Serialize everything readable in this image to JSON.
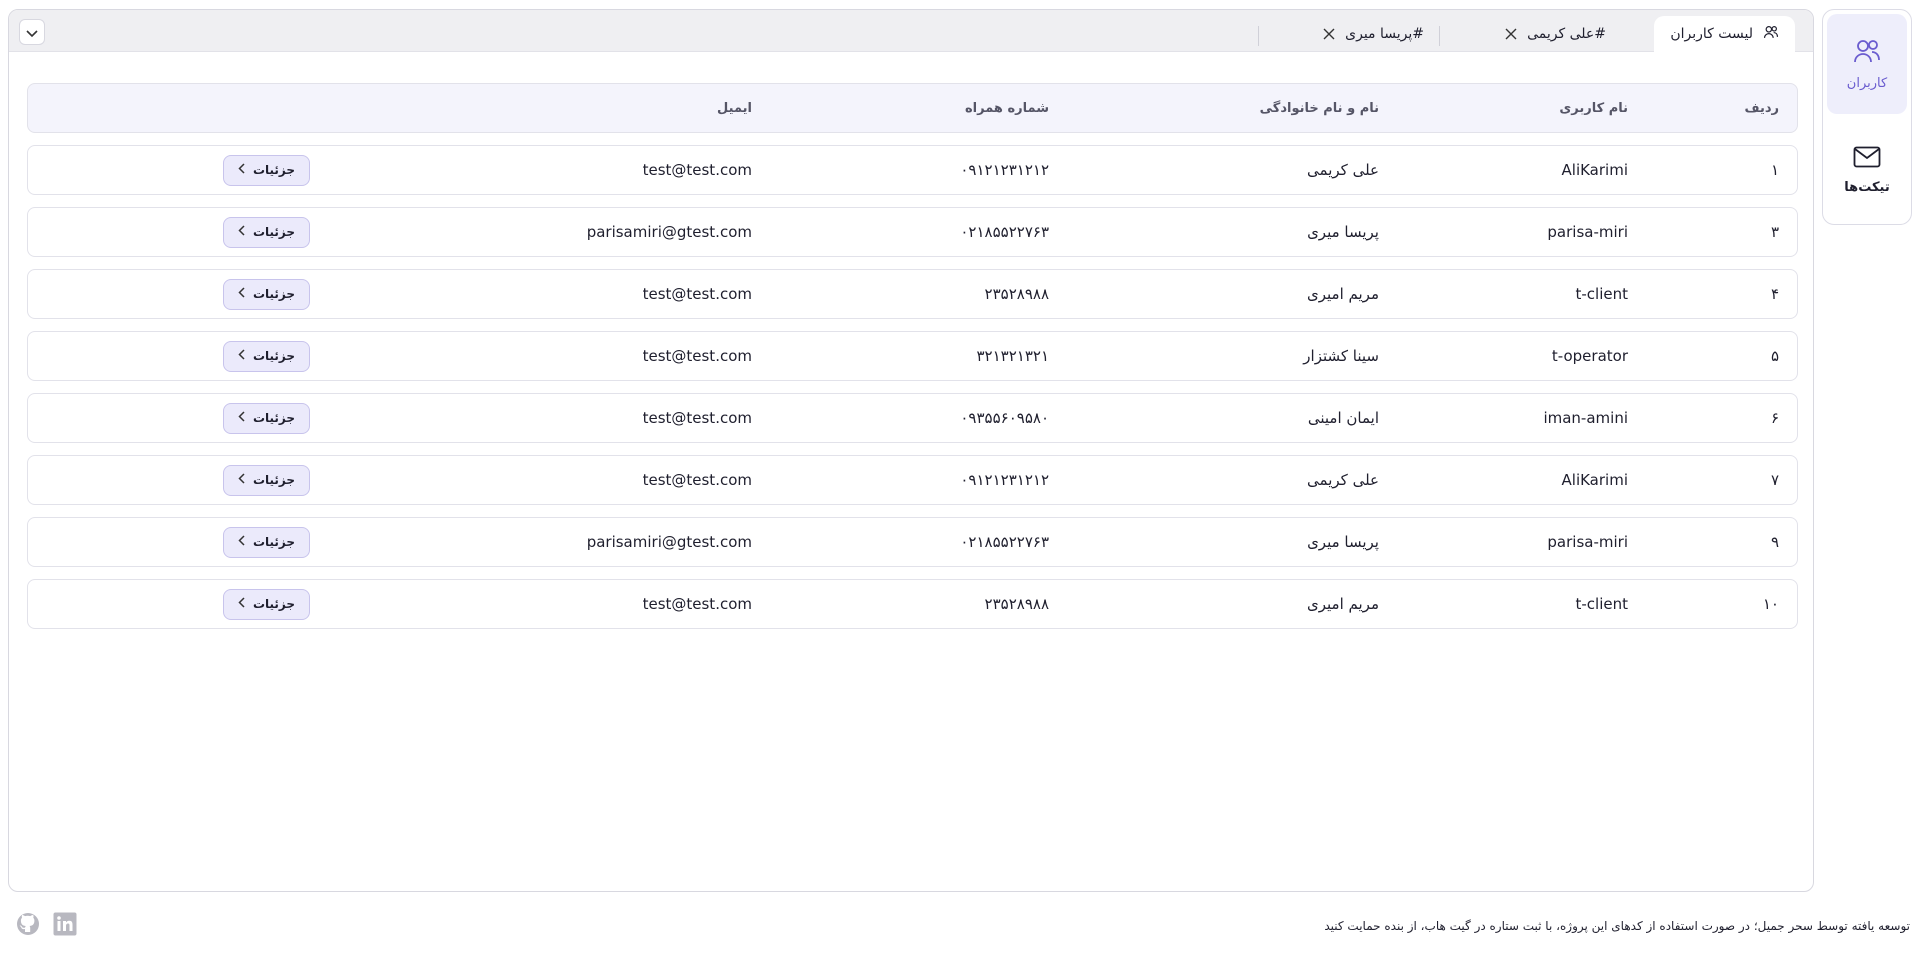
{
  "sidebar": {
    "items": [
      {
        "label": "کاربران",
        "icon": "users-icon",
        "active": true
      },
      {
        "label": "تیکت‌ها",
        "icon": "mail-icon",
        "active": false
      }
    ]
  },
  "tabs": [
    {
      "label": "لیست کاربران",
      "icon": "users-icon",
      "active": true
    },
    {
      "label": "#علی کریمی",
      "closable": true
    },
    {
      "label": "#پریسا میری",
      "closable": true
    }
  ],
  "table": {
    "headers": {
      "index": "ردیف",
      "username": "نام کاربری",
      "fullname": "نام و نام خانوادگی",
      "phone": "شماره همراه",
      "email": "ایمیل"
    },
    "details_label": "جزئیات",
    "rows": [
      {
        "index": "۱",
        "username": "AliKarimi",
        "fullname": "علی کریمی",
        "phone": "۰۹۱۲۱۲۳۱۲۱۲",
        "email": "test@test.com"
      },
      {
        "index": "۳",
        "username": "parisa-miri",
        "fullname": "پریسا میری",
        "phone": "۰۲۱۸۵۵۲۲۷۶۳",
        "email": "parisamiri@gtest.com"
      },
      {
        "index": "۴",
        "username": "t-client",
        "fullname": "مریم امیری",
        "phone": "۲۳۵۲۸۹۸۸",
        "email": "test@test.com"
      },
      {
        "index": "۵",
        "username": "t-operator",
        "fullname": "سینا کشتزار",
        "phone": "۳۲۱۳۲۱۳۲۱",
        "email": "test@test.com"
      },
      {
        "index": "۶",
        "username": "iman-amini",
        "fullname": "ایمان امینی",
        "phone": "۰۹۳۵۵۶۰۹۵۸۰",
        "email": "test@test.com"
      },
      {
        "index": "۷",
        "username": "AliKarimi",
        "fullname": "علی کریمی",
        "phone": "۰۹۱۲۱۲۳۱۲۱۲",
        "email": "test@test.com"
      },
      {
        "index": "۹",
        "username": "parisa-miri",
        "fullname": "پریسا میری",
        "phone": "۰۲۱۸۵۵۲۲۷۶۳",
        "email": "parisamiri@gtest.com"
      },
      {
        "index": "۱۰",
        "username": "t-client",
        "fullname": "مریم امیری",
        "phone": "۲۳۵۲۸۹۸۸",
        "email": "test@test.com"
      }
    ]
  },
  "footer": {
    "text": "توسعه یافته توسط سحر جمیل؛ در صورت استفاده از کدهای این پروژه، با ثبت ستاره در گیت هاب، از بنده حمایت کنید",
    "links": [
      {
        "icon": "github-icon"
      },
      {
        "icon": "linkedin-icon"
      }
    ]
  },
  "colors": {
    "accent": "#6a5ccf",
    "accent_bg": "#ebeafb",
    "header_bg": "#f4f4fc"
  }
}
